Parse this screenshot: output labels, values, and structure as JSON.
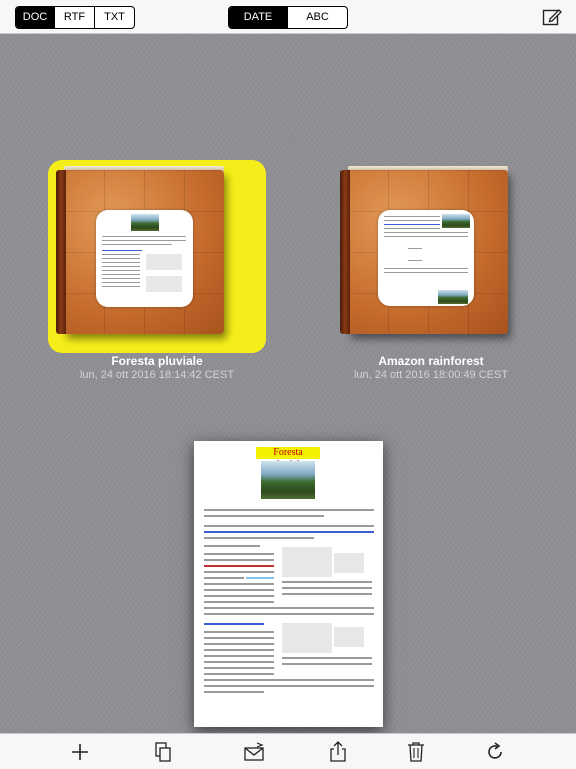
{
  "toolbar": {
    "format_tabs": [
      "DOC",
      "RTF",
      "TXT"
    ],
    "selected_format": "DOC",
    "sort_tabs": [
      "DATE",
      "ABC"
    ],
    "selected_sort": "DATE",
    "compose_icon": "compose-icon"
  },
  "documents": [
    {
      "title": "Foresta pluviale",
      "date": "lun, 24 ott 2016 18:14:42 CEST",
      "selected": true
    },
    {
      "title": "Amazon rainforest",
      "date": "lun, 24 ott 2016 18:00:49 CEST",
      "selected": false
    }
  ],
  "preview": {
    "title": "Foresta pluviale"
  },
  "bottom_toolbar": [
    "add-icon",
    "duplicate-icon",
    "mail-icon",
    "share-icon",
    "trash-icon",
    "refresh-icon"
  ],
  "colors": {
    "highlight": "#f5ee1a",
    "accent": "#000000"
  }
}
